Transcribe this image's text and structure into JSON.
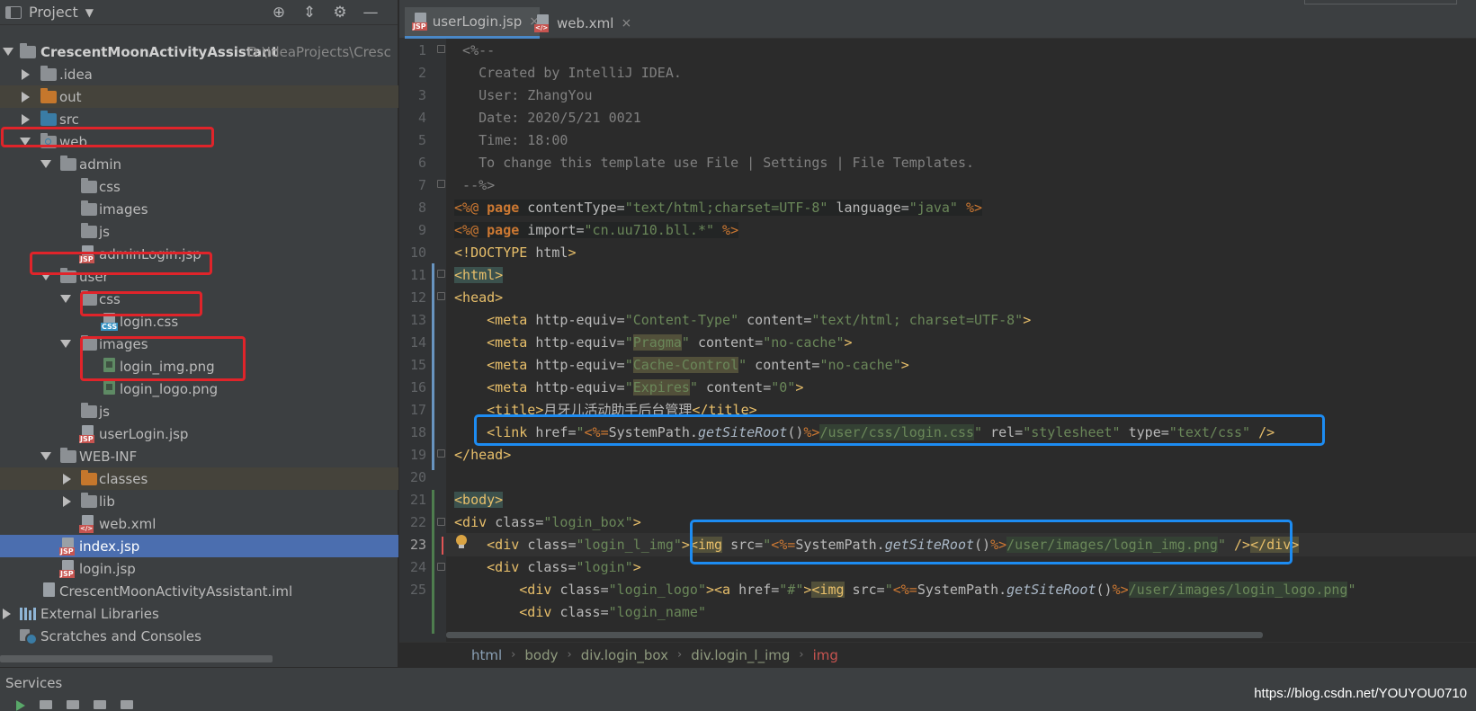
{
  "project_panel": {
    "title": "Project",
    "tree": [
      {
        "label": "CrescentMoonActivityAssistant",
        "path": "D:\\IdeaProjects\\Cresc"
      },
      {
        "label": ".idea"
      },
      {
        "label": "out"
      },
      {
        "label": "src"
      },
      {
        "label": "web"
      },
      {
        "label": "admin"
      },
      {
        "label": "css"
      },
      {
        "label": "images"
      },
      {
        "label": "js"
      },
      {
        "label": "adminLogin.jsp"
      },
      {
        "label": "user"
      },
      {
        "label": "css"
      },
      {
        "label": "login.css"
      },
      {
        "label": "images"
      },
      {
        "label": "login_img.png"
      },
      {
        "label": "login_logo.png"
      },
      {
        "label": "js"
      },
      {
        "label": "userLogin.jsp"
      },
      {
        "label": "WEB-INF"
      },
      {
        "label": "classes"
      },
      {
        "label": "lib"
      },
      {
        "label": "web.xml"
      },
      {
        "label": "index.jsp"
      },
      {
        "label": "login.jsp"
      },
      {
        "label": "CrescentMoonActivityAssistant.iml"
      },
      {
        "label": "External Libraries"
      },
      {
        "label": "Scratches and Consoles"
      }
    ]
  },
  "editor": {
    "tabs": [
      {
        "label": "userLogin.jsp",
        "active": true,
        "close": "×"
      },
      {
        "label": "web.xml",
        "active": false,
        "close": "×"
      }
    ],
    "line_numbers": [
      "1",
      "2",
      "3",
      "4",
      "5",
      "6",
      "7",
      "8",
      "9",
      "10",
      "11",
      "12",
      "13",
      "14",
      "15",
      "16",
      "17",
      "18",
      "19",
      "20",
      "21",
      "22",
      "23",
      "24",
      "25"
    ],
    "current_line": "23"
  },
  "breadcrumb": [
    "html",
    "body",
    "div.login_box",
    "div.login_l_img",
    "img"
  ],
  "services": {
    "title": "Services"
  },
  "watermark": "https://blog.csdn.net/YOUYOU0710",
  "colors": {
    "panel_bg": "#3c3f41",
    "editor_bg": "#2b2b2b",
    "selection": "#4b6eaf",
    "annotation_red": "#e0242a",
    "annotation_blue": "#1d8cf2"
  }
}
